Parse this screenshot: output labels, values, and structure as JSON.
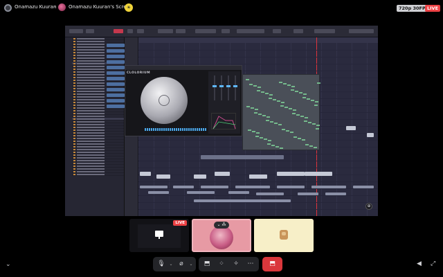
{
  "header": {
    "server_name": "Onamazu Kuuran",
    "crumb_separator": "›",
    "screen_title": "Onamazu Kuuran's Screen",
    "boost_badge": "☀",
    "stream_quality": "720p 30FPS",
    "live_label": "LIVE"
  },
  "stream": {
    "plugin_name": "CLOLORIUM",
    "zoom_glyph": "⊕"
  },
  "tiles": {
    "tile_live_label": "LIVE",
    "tile_2_controls": "⌄ ⁂"
  },
  "controls": {
    "collapse_glyph": "⌄",
    "mic_glyph": "🎙",
    "camera_glyph": "⌀",
    "caret_glyph": "⌄",
    "share_glyph": "⬒",
    "activities_glyph": "⁘",
    "effects_glyph": "✧",
    "more_glyph": "⋯",
    "leave_glyph": "⬒",
    "volume_glyph": "◀",
    "fullscreen_glyph": "⤢"
  },
  "colors": {
    "accent_live": "#ed4245",
    "leave": "#da373c",
    "playhead": "#e0343c"
  }
}
